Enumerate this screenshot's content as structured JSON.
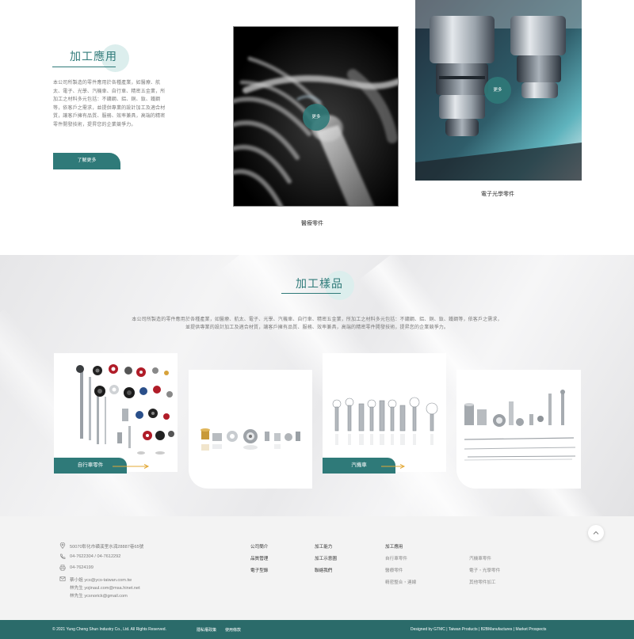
{
  "application": {
    "title": "加工應用",
    "description": "本公司所製造的零件應用於各種產業，如醫療、航太、電子、光學、汽機車、自行車、精密五金業，所加工之材料多元包括：不鏽鋼、鋁、銅、鈦、鐵鋼等，依客戶之需求，並提供專業的設計加工及適合材質，讓客戶擁有品質、服務、效率兼具，高端的精密零件開發技術，提昇您的企業競爭力。",
    "more_button": "了解更多",
    "items": [
      {
        "caption": "醫療零件",
        "more": "更多"
      },
      {
        "caption": "電子光學零件",
        "more": "更多"
      }
    ]
  },
  "samples": {
    "title": "加工樣品",
    "description_line1": "本公司所製造的零件應用於各種產業，如醫療、航太、電子、光學、汽機車、自行車、精密五金業，所加工之材料多元包括：不鏽鋼、鋁、銅、鈦、鐵鋼等，依客戶之需求，",
    "description_line2": "並提供專業的設計加工及適合材質，讓客戶擁有品質、服務、效率兼具，高端的精密零件開發技術，提昇您的企業競爭力。",
    "cards": [
      {
        "label": "自行車零件"
      },
      {
        "label": "汽機車"
      }
    ]
  },
  "footer": {
    "contact": {
      "address": "50070彰化市磺溪里水湳28887巷65號",
      "phone": "04-7622304 / 04-7612292",
      "fax": "04-7624199",
      "emails": [
        "蔡小姐 ycs@ycs-taiwan.com.tw",
        "林先生 yojinaul.com@msa.hinet.net",
        "林先生 ycsnorick@gmail.com"
      ]
    },
    "nav": {
      "company": [
        "公司簡介",
        "品質管理",
        "電子型錄"
      ],
      "capabilities": [
        "加工能力",
        "加工示意圖",
        "聯絡我們"
      ],
      "applications": {
        "title": "加工應用",
        "items": [
          "自行車零件",
          "醫療零件",
          "精密整合・連線",
          "汽機車零件",
          "電子・光學零件",
          "其他零件加工"
        ]
      }
    },
    "copyright": "© 2021 Yung Cheng Shun Industry Co., Ltd.  All Rights Reserved.",
    "privacy": "隱私權政策",
    "terms": "使用條款",
    "credits": [
      "Designed by GTMC",
      "Taiwan Products",
      "B2BManufactures",
      "Market Prospects"
    ]
  },
  "icons": [
    "location-pin-icon",
    "phone-icon",
    "printer-icon",
    "mail-icon",
    "chevron-up-icon",
    "arrow-right-icon"
  ],
  "colors": {
    "primary": "#2f7a79",
    "mint": "#dceeed",
    "accent_arrow": "#e3a835",
    "footer_bar": "#2b6b6a",
    "footer_bg": "#f3f3f3"
  }
}
